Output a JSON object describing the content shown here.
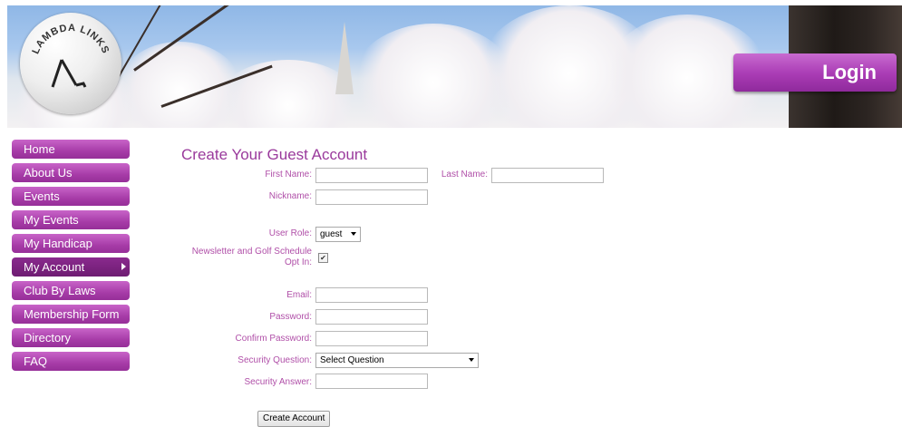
{
  "header": {
    "logo_text": "LAMBDA LINKS",
    "login_label": "Login"
  },
  "sidebar": {
    "items": [
      {
        "label": "Home"
      },
      {
        "label": "About Us"
      },
      {
        "label": "Events"
      },
      {
        "label": "My Events"
      },
      {
        "label": "My Handicap"
      },
      {
        "label": "My Account"
      },
      {
        "label": "Club By Laws"
      },
      {
        "label": "Membership Form"
      },
      {
        "label": "Directory"
      },
      {
        "label": "FAQ"
      }
    ],
    "active_index": 5
  },
  "form": {
    "title": "Create Your Guest Account",
    "first_name_label": "First Name:",
    "first_name_value": "",
    "last_name_label": "Last Name:",
    "last_name_value": "",
    "nickname_label": "Nickname:",
    "nickname_value": "",
    "user_role_label": "User Role:",
    "user_role_value": "guest",
    "newsletter_label_1": "Newsletter and Golf Schedule",
    "newsletter_label_2": "Opt In:",
    "newsletter_checked": true,
    "email_label": "Email:",
    "email_value": "",
    "password_label": "Password:",
    "password_value": "",
    "confirm_password_label": "Confirm Password:",
    "confirm_password_value": "",
    "security_question_label": "Security Question:",
    "security_question_value": "Select Question",
    "security_answer_label": "Security Answer:",
    "security_answer_value": "",
    "submit_label": "Create Account"
  },
  "colors": {
    "accent": "#a73ca8",
    "label": "#b04fa8",
    "title": "#9a3a9c"
  }
}
